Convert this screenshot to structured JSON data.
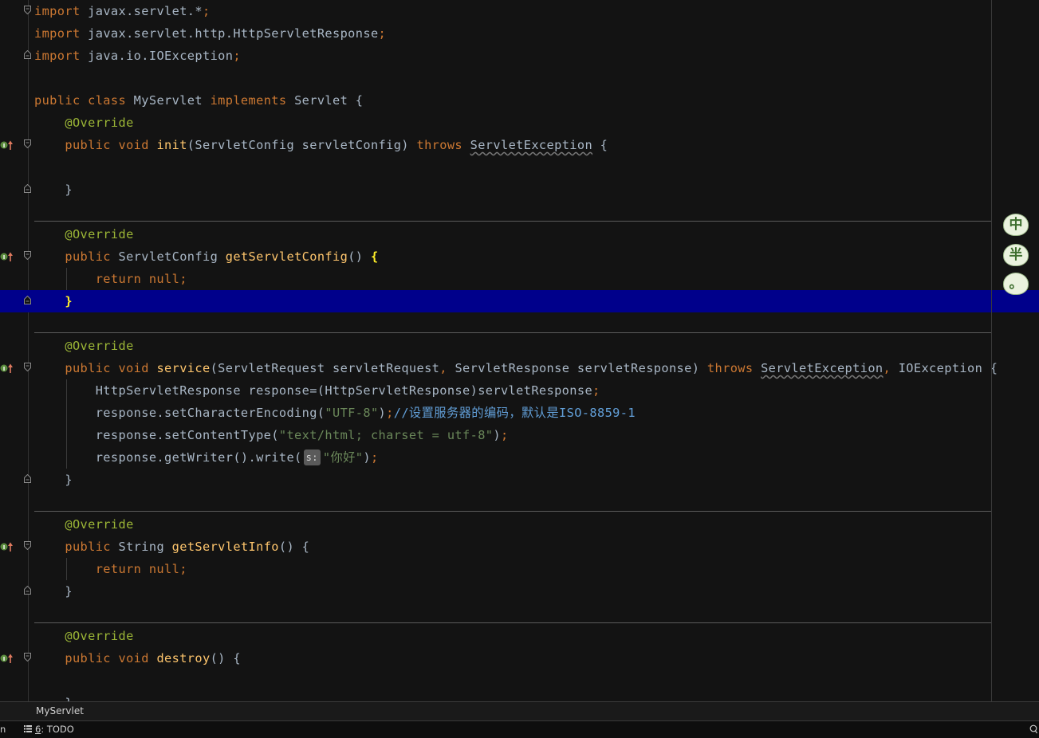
{
  "editor": {
    "file_name": "MyServlet",
    "lines": [
      {
        "fold": "open",
        "tokens": [
          [
            "kw",
            "import "
          ],
          [
            "pl",
            "javax.servlet.*"
          ],
          [
            "kw",
            ";"
          ]
        ]
      },
      {
        "tokens": [
          [
            "kw",
            "import "
          ],
          [
            "pl",
            "javax.servlet.http.HttpServletResponse"
          ],
          [
            "kw",
            ";"
          ]
        ]
      },
      {
        "fold": "close",
        "tokens": [
          [
            "kw",
            "import "
          ],
          [
            "pl",
            "java.io.IOException"
          ],
          [
            "kw",
            ";"
          ]
        ]
      },
      {
        "tokens": []
      },
      {
        "tokens": [
          [
            "kw",
            "public class "
          ],
          [
            "pl",
            "MyServlet "
          ],
          [
            "kw",
            "implements "
          ],
          [
            "pl",
            "Servlet {"
          ]
        ]
      },
      {
        "tokens": [
          [
            "pl",
            "    "
          ],
          [
            "an",
            "@Override"
          ]
        ]
      },
      {
        "marker": "implements",
        "fold": "open",
        "tokens": [
          [
            "pl",
            "    "
          ],
          [
            "kw",
            "public void "
          ],
          [
            "fn",
            "init"
          ],
          [
            "pl",
            "(ServletConfig servletConfig) "
          ],
          [
            "kw",
            "throws "
          ],
          [
            "warn",
            "ServletException"
          ],
          [
            "pl",
            " {"
          ]
        ]
      },
      {
        "tokens": []
      },
      {
        "fold": "close",
        "tokens": [
          [
            "pl",
            "    }"
          ]
        ]
      },
      {
        "tokens": []
      },
      {
        "tokens": [
          [
            "pl",
            "    "
          ],
          [
            "an",
            "@Override"
          ]
        ]
      },
      {
        "marker": "implements",
        "fold": "open",
        "tokens": [
          [
            "pl",
            "    "
          ],
          [
            "kw",
            "public "
          ],
          [
            "pl",
            "ServletConfig "
          ],
          [
            "fn",
            "getServletConfig"
          ],
          [
            "pl",
            "() "
          ],
          [
            "brace-hl",
            "{"
          ]
        ]
      },
      {
        "tokens": [
          [
            "pl",
            "        "
          ],
          [
            "kw",
            "return null;"
          ]
        ]
      },
      {
        "highlight": true,
        "fold": "close",
        "tokens": [
          [
            "pl",
            "    "
          ],
          [
            "brace-hl",
            "}"
          ]
        ]
      },
      {
        "tokens": []
      },
      {
        "tokens": [
          [
            "pl",
            "    "
          ],
          [
            "an",
            "@Override"
          ]
        ]
      },
      {
        "marker": "implements",
        "fold": "open",
        "tokens": [
          [
            "pl",
            "    "
          ],
          [
            "kw",
            "public void "
          ],
          [
            "fn",
            "service"
          ],
          [
            "pl",
            "(ServletRequest servletRequest"
          ],
          [
            "kw",
            ", "
          ],
          [
            "pl",
            "ServletResponse servletResponse) "
          ],
          [
            "kw",
            "throws "
          ],
          [
            "warn",
            "ServletException"
          ],
          [
            "kw",
            ", "
          ],
          [
            "pl",
            "IOException {"
          ]
        ]
      },
      {
        "tokens": [
          [
            "pl",
            "        HttpServletResponse response=(HttpServletResponse)servletResponse"
          ],
          [
            "kw",
            ";"
          ]
        ]
      },
      {
        "tokens": [
          [
            "pl",
            "        response.setCharacterEncoding("
          ],
          [
            "str",
            "\"UTF-8\""
          ],
          [
            "pl",
            ")"
          ],
          [
            "kw",
            ";"
          ],
          [
            "cm",
            "//设置服务器的编码，默认是ISO-8859-1"
          ]
        ]
      },
      {
        "tokens": [
          [
            "pl",
            "        response.setContentType("
          ],
          [
            "str",
            "\"text/html; charset = utf-8\""
          ],
          [
            "pl",
            ")"
          ],
          [
            "kw",
            ";"
          ]
        ]
      },
      {
        "tokens": [
          [
            "pl",
            "        response.getWriter().write("
          ],
          [
            "hint",
            "s:"
          ],
          [
            "str",
            "\"你好\""
          ],
          [
            "pl",
            ")"
          ],
          [
            "kw",
            ";"
          ]
        ]
      },
      {
        "fold": "close",
        "tokens": [
          [
            "pl",
            "    }"
          ]
        ]
      },
      {
        "tokens": []
      },
      {
        "tokens": [
          [
            "pl",
            "    "
          ],
          [
            "an",
            "@Override"
          ]
        ]
      },
      {
        "marker": "implements",
        "fold": "open",
        "tokens": [
          [
            "pl",
            "    "
          ],
          [
            "kw",
            "public "
          ],
          [
            "pl",
            "String "
          ],
          [
            "fn",
            "getServletInfo"
          ],
          [
            "pl",
            "() {"
          ]
        ]
      },
      {
        "tokens": [
          [
            "pl",
            "        "
          ],
          [
            "kw",
            "return null;"
          ]
        ]
      },
      {
        "fold": "close",
        "tokens": [
          [
            "pl",
            "    }"
          ]
        ]
      },
      {
        "tokens": []
      },
      {
        "tokens": [
          [
            "pl",
            "    "
          ],
          [
            "an",
            "@Override"
          ]
        ]
      },
      {
        "marker": "implements",
        "fold": "open",
        "tokens": [
          [
            "pl",
            "    "
          ],
          [
            "kw",
            "public void "
          ],
          [
            "fn",
            "destroy"
          ],
          [
            "pl",
            "() {"
          ]
        ]
      },
      {
        "tokens": []
      },
      {
        "tokens": [
          [
            "pl",
            "    }"
          ]
        ]
      }
    ]
  },
  "ime_widget": {
    "buttons": [
      "中",
      "半",
      "。"
    ]
  },
  "toolwindow_bar": {
    "left_fragment": "n",
    "todo_number": "6",
    "todo_label": ": TODO"
  },
  "colors": {
    "background": "#131313",
    "keyword": "#cc7832",
    "function": "#ffc66d",
    "annotation": "#9bb536",
    "string": "#6a8759",
    "comment": "#629fd8",
    "caret_line": "#00008b"
  }
}
